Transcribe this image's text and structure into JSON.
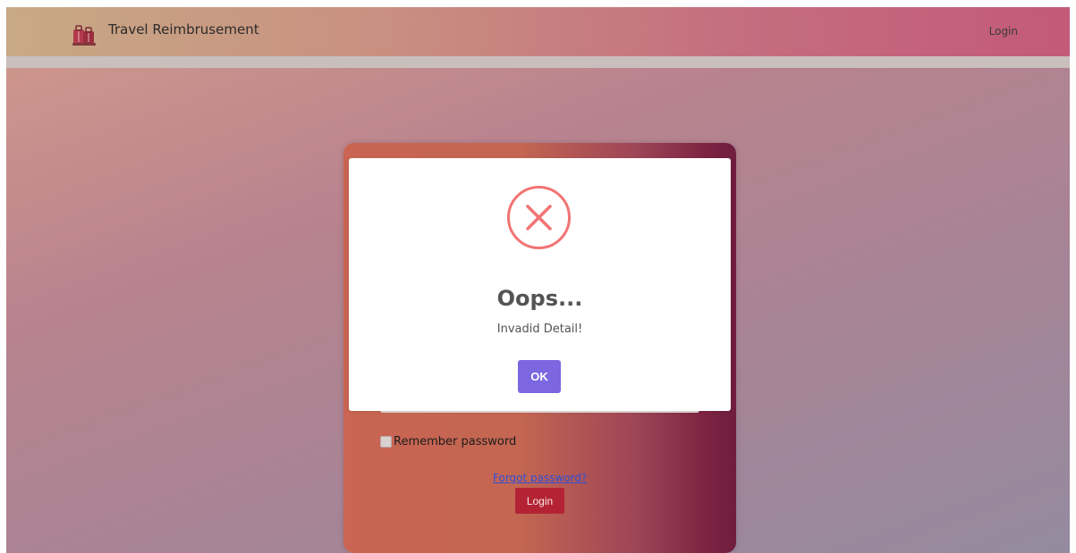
{
  "navbar": {
    "brand_title": "Travel Reimbrusement",
    "login_link": "Login"
  },
  "login_form": {
    "remember_label": "Remember password",
    "remember_checked": false,
    "forgot_link": "Forgot password?",
    "login_button": "Login"
  },
  "modal": {
    "icon": "error-x-icon",
    "title": "Oops...",
    "text": "Invadid Detail!",
    "ok_button": "OK"
  },
  "colors": {
    "error_icon": "#f27474",
    "ok_button": "#7c67e0",
    "login_button": "#b32333",
    "forgot_link": "#2f4fd8"
  }
}
